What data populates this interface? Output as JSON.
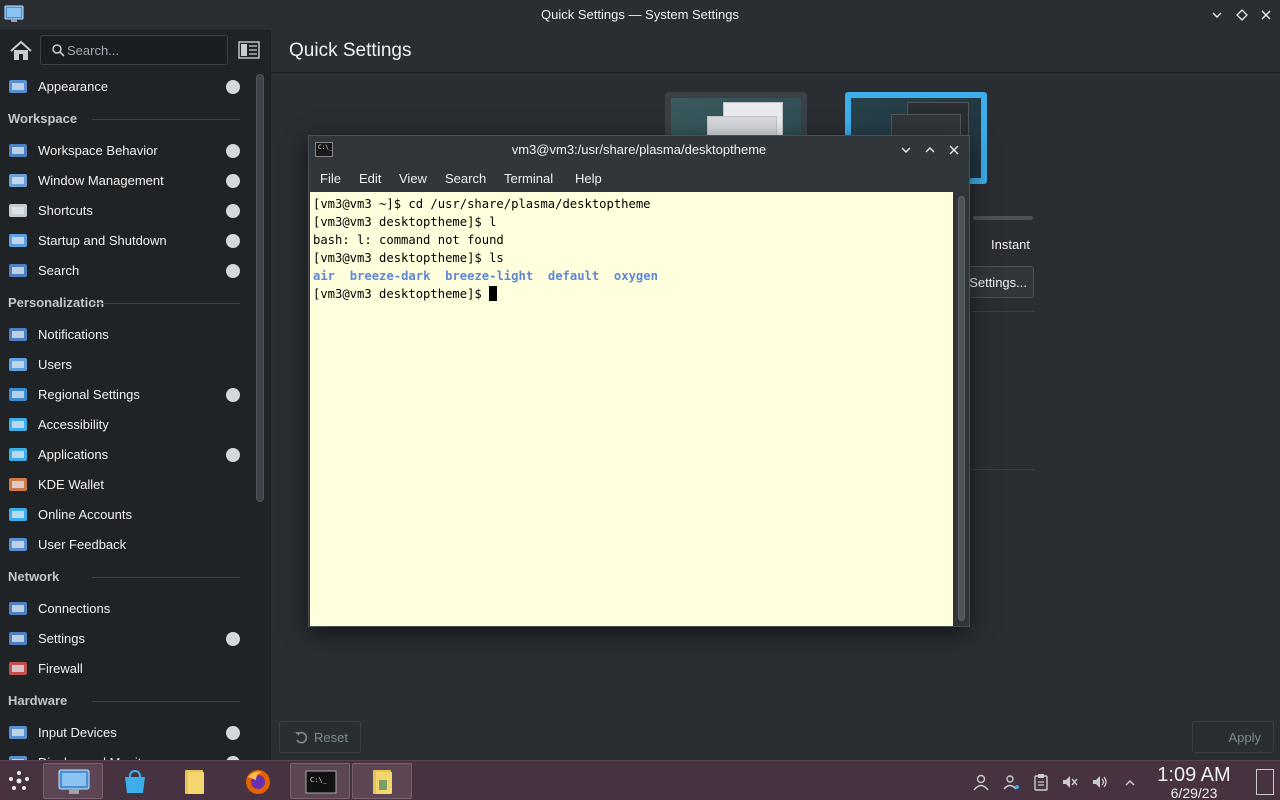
{
  "window": {
    "title": "Quick Settings — System Settings"
  },
  "sidebar": {
    "search_placeholder": "Search...",
    "items": [
      {
        "type": "item",
        "label": "Appearance",
        "icon": "appearance-icon",
        "dot": true
      },
      {
        "type": "header",
        "label": "Workspace"
      },
      {
        "type": "item",
        "label": "Workspace Behavior",
        "icon": "workspace-behavior-icon",
        "dot": true
      },
      {
        "type": "item",
        "label": "Window Management",
        "icon": "window-management-icon",
        "dot": true
      },
      {
        "type": "item",
        "label": "Shortcuts",
        "icon": "shortcuts-icon",
        "dot": true
      },
      {
        "type": "item",
        "label": "Startup and Shutdown",
        "icon": "startup-shutdown-icon",
        "dot": true
      },
      {
        "type": "item",
        "label": "Search",
        "icon": "search-settings-icon",
        "dot": true
      },
      {
        "type": "header",
        "label": "Personalization"
      },
      {
        "type": "item",
        "label": "Notifications",
        "icon": "notifications-icon",
        "dot": false
      },
      {
        "type": "item",
        "label": "Users",
        "icon": "users-icon",
        "dot": false
      },
      {
        "type": "item",
        "label": "Regional Settings",
        "icon": "regional-settings-icon",
        "dot": true
      },
      {
        "type": "item",
        "label": "Accessibility",
        "icon": "accessibility-icon",
        "dot": false
      },
      {
        "type": "item",
        "label": "Applications",
        "icon": "applications-icon",
        "dot": true
      },
      {
        "type": "item",
        "label": "KDE Wallet",
        "icon": "kde-wallet-icon",
        "dot": false
      },
      {
        "type": "item",
        "label": "Online Accounts",
        "icon": "online-accounts-icon",
        "dot": false
      },
      {
        "type": "item",
        "label": "User Feedback",
        "icon": "user-feedback-icon",
        "dot": false
      },
      {
        "type": "header",
        "label": "Network"
      },
      {
        "type": "item",
        "label": "Connections",
        "icon": "connections-icon",
        "dot": false
      },
      {
        "type": "item",
        "label": "Settings",
        "icon": "network-settings-icon",
        "dot": true
      },
      {
        "type": "item",
        "label": "Firewall",
        "icon": "firewall-icon",
        "dot": false
      },
      {
        "type": "header",
        "label": "Hardware"
      },
      {
        "type": "item",
        "label": "Input Devices",
        "icon": "input-devices-icon",
        "dot": true
      },
      {
        "type": "item",
        "label": "Display and Monitor",
        "icon": "display-monitor-icon",
        "dot": true
      }
    ]
  },
  "main": {
    "page_title": "Quick Settings",
    "instant_label": "Instant",
    "settings_button": "Settings...",
    "reset_button": "Reset",
    "apply_button": "Apply"
  },
  "konsole": {
    "title": "vm3@vm3:/usr/share/plasma/desktoptheme",
    "icon_text": "C:\\_",
    "menu": [
      "File",
      "Edit",
      "View",
      "Search",
      "Terminal",
      "Help"
    ],
    "lines": [
      "[vm3@vm3 ~]$ cd /usr/share/plasma/desktoptheme",
      "[vm3@vm3 desktoptheme]$ l",
      "bash: l: command not found",
      "[vm3@vm3 desktoptheme]$ ls"
    ],
    "ls_output": [
      "air",
      "breeze-dark",
      "breeze-light",
      "default",
      "oxygen"
    ],
    "prompt": "[vm3@vm3 desktoptheme]$ "
  },
  "taskbar": {
    "clock_time": "1:09 AM",
    "clock_date": "6/29/23"
  },
  "colors": {
    "terminal_bg": "#ffffdd",
    "ls_dir": "#5f87d7",
    "taskbar_bg": "#463240",
    "accent": "#3daee9"
  }
}
